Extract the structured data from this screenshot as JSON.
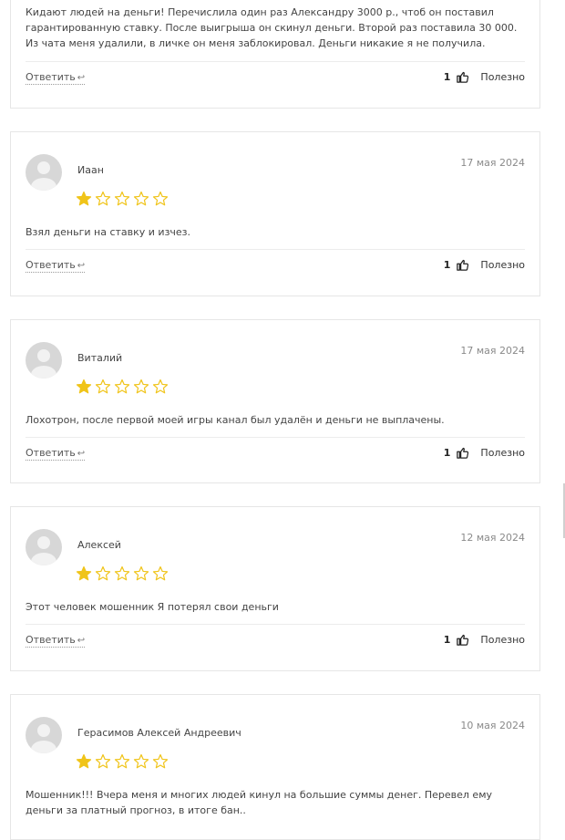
{
  "colors": {
    "star_filled": "#f0c419",
    "star_empty": "#f0c419",
    "border": "#e6e6e6"
  },
  "labels": {
    "reply": "Ответить",
    "useful": "Полезно"
  },
  "icons": {
    "reply": "reply-arrow-icon",
    "thumb": "thumbs-up-icon",
    "avatar": "user-avatar-icon",
    "star": "star-icon"
  },
  "reviews": [
    {
      "text": "Кидают людей на деньги! Перечислила один раз Александру 3000 р., чтоб он поставил гарантированную ставку. После выигрыша он скинул деньги. Второй раз поставила 30 000. Из чата меня удалили, в личке он меня заблокировал. Деньги никакие я не получила.",
      "votes": "1"
    },
    {
      "name": "Иаан",
      "date": "17 мая 2024",
      "rating": 1,
      "text": "Взял деньги на ставку и изчез.",
      "votes": "1"
    },
    {
      "name": "Виталий",
      "date": "17 мая 2024",
      "rating": 1,
      "text": "Лохотрон, после первой моей игры канал был удалён и деньги не выплачены.",
      "votes": "1"
    },
    {
      "name": "Алексей",
      "date": "12 мая 2024",
      "rating": 1,
      "text": "Этот человек мошенник Я потерял свои деньги",
      "votes": "1"
    },
    {
      "name": "Герасимов Алексей Андреевич",
      "date": "10 мая 2024",
      "rating": 1,
      "text": "Мошенник!!! Вчера меня и многих людей кинул на большие суммы денег. Перевел ему деньги за платный прогноз, в итоге бан.."
    }
  ]
}
